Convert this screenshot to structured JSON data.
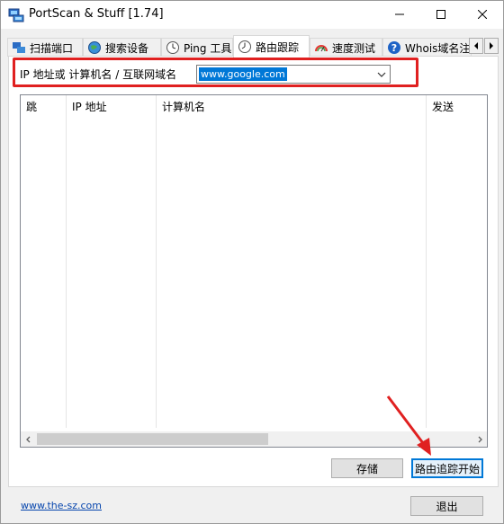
{
  "window": {
    "title": "PortScan & Stuff [1.74]"
  },
  "tabs": [
    {
      "label": "扫描端口",
      "icon": "network-icon",
      "active": false
    },
    {
      "label": "搜索设备",
      "icon": "globe-icon",
      "active": false
    },
    {
      "label": "Ping 工具",
      "icon": "ping-clock-icon",
      "active": false
    },
    {
      "label": "路由跟踪",
      "icon": "trace-clock-icon",
      "active": true
    },
    {
      "label": "速度测试",
      "icon": "speedometer-icon",
      "active": false
    },
    {
      "label": "Whois域名注",
      "icon": "help-circle-icon",
      "active": false
    }
  ],
  "trace": {
    "host_label": "IP 地址或 计算机名 / 互联网域名",
    "host_value": "www.google.com"
  },
  "table": {
    "columns": [
      "跳",
      "IP 地址",
      "计算机名",
      "发送"
    ],
    "rows": []
  },
  "buttons": {
    "save": "存储",
    "start_trace": "路由追踪开始",
    "exit": "退出"
  },
  "footer": {
    "website": "www.the-sz.com"
  },
  "colors": {
    "highlight_red": "#e02020",
    "selection_blue": "#0078d7",
    "link_blue": "#0645ad"
  }
}
